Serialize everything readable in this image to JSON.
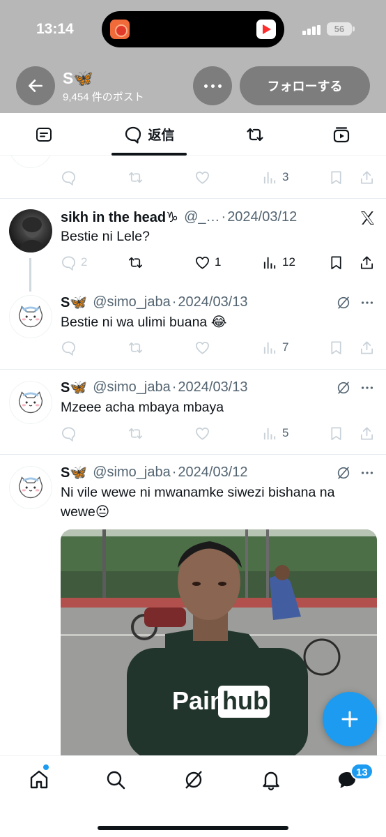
{
  "status_bar": {
    "time": "13:14",
    "battery": "56"
  },
  "header": {
    "profile_name": "S🦋",
    "post_count": "9,454 件のポスト",
    "follow_label": "フォローする"
  },
  "tabs": [
    {
      "icon": "article-icon"
    },
    {
      "icon": "reply-bubble-icon",
      "label": "返信",
      "active": true
    },
    {
      "icon": "retweet-icon"
    },
    {
      "icon": "video-icon"
    }
  ],
  "tweets": [
    {
      "id": "t0",
      "partial": true,
      "views": "3"
    },
    {
      "id": "t1",
      "name": "sikh in the head♑",
      "handle": "@_…",
      "date": "2024/03/12",
      "text": "Bestie ni Lele?",
      "replies": "2",
      "likes": "1",
      "views": "12",
      "corner_icon": "x-logo-icon"
    },
    {
      "id": "t2",
      "name": "S🦋",
      "handle": "@simo_jaba",
      "date": "2024/03/13",
      "text": "Bestie ni wa ulimi buana 😂",
      "views": "7"
    },
    {
      "id": "t3",
      "name": "S🦋",
      "handle": "@simo_jaba",
      "date": "2024/03/13",
      "text": "Mzeee acha mbaya mbaya",
      "views": "5"
    },
    {
      "id": "t4",
      "name": "S🦋",
      "handle": "@simo_jaba",
      "date": "2024/03/12",
      "text_line1": "Ni vile wewe ni mwanamke siwezi bishana na",
      "text_line2": "wewe😐",
      "image": {
        "shirt_text_left": "Pain",
        "shirt_text_box": "hub"
      }
    }
  ],
  "bottom_nav": {
    "items": [
      "home-icon",
      "search-icon",
      "grok-icon",
      "notifications-icon",
      "messages-icon"
    ],
    "messages_badge": "13"
  },
  "colors": {
    "accent": "#1d9bf0",
    "header_grey": "#b7b7b7",
    "button_grey": "#7d7d7d"
  }
}
